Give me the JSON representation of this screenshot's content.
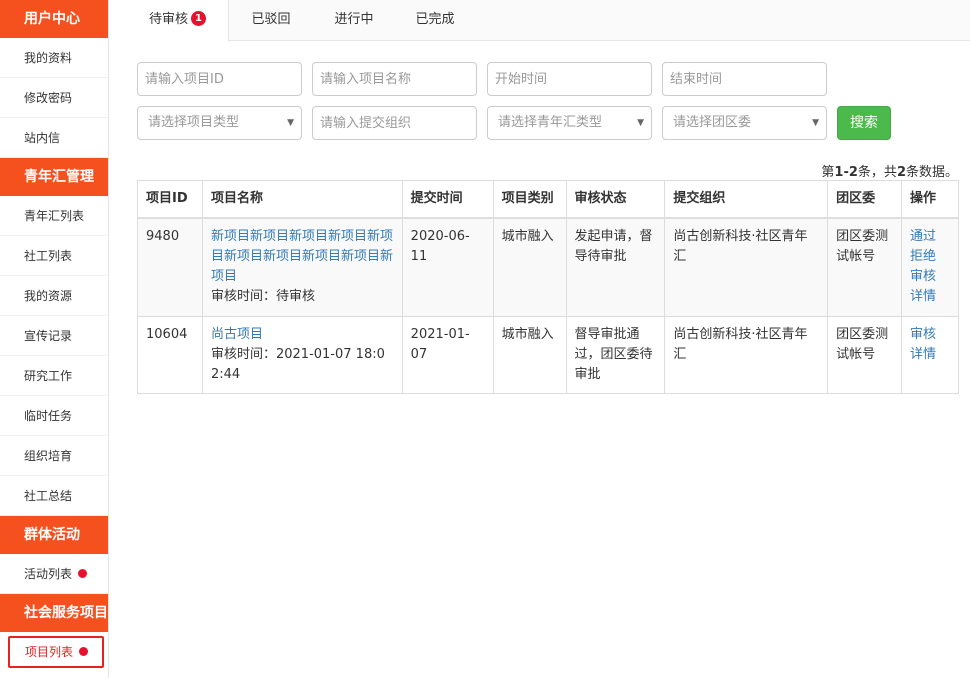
{
  "sidebar": {
    "sections": [
      {
        "title": "用户中心",
        "items": [
          {
            "label": "我的资料"
          },
          {
            "label": "修改密码"
          },
          {
            "label": "站内信"
          }
        ]
      },
      {
        "title": "青年汇管理",
        "items": [
          {
            "label": "青年汇列表"
          },
          {
            "label": "社工列表"
          },
          {
            "label": "我的资源"
          },
          {
            "label": "宣传记录"
          },
          {
            "label": "研究工作"
          },
          {
            "label": "临时任务"
          },
          {
            "label": "组织培育"
          },
          {
            "label": "社工总结"
          }
        ]
      },
      {
        "title": "群体活动",
        "items": [
          {
            "label": "活动列表",
            "dot": true
          }
        ]
      },
      {
        "title": "社会服务项目",
        "items": [
          {
            "label": "项目列表",
            "dot": true,
            "active": true
          }
        ]
      }
    ]
  },
  "tabs": [
    {
      "label": "待审核",
      "badge": "1",
      "active": true
    },
    {
      "label": "已驳回"
    },
    {
      "label": "进行中"
    },
    {
      "label": "已完成"
    }
  ],
  "filters": {
    "project_id_placeholder": "请输入项目ID",
    "project_name_placeholder": "请输入项目名称",
    "start_time_placeholder": "开始时间",
    "end_time_placeholder": "结束时间",
    "project_type_select": "请选择项目类型",
    "org_placeholder": "请输入提交组织",
    "youth_type_select": "请选择青年汇类型",
    "league_select": "请选择团区委",
    "search_label": "搜索"
  },
  "summary": {
    "prefix": "第",
    "range": "1-2",
    "middle": "条，共",
    "total": "2",
    "suffix": "条数据。"
  },
  "table": {
    "headers": [
      "项目ID",
      "项目名称",
      "提交时间",
      "项目类别",
      "审核状态",
      "提交组织",
      "团区委",
      "操作"
    ],
    "rows": [
      {
        "id": "9480",
        "name": "新项目新项目新项目新项目新项目新项目新项目新项目新项目新项目",
        "review_time": "审核时间：待审核",
        "submit_time": "2020-06-11",
        "category": "城市融入",
        "status": "发起申请，督导待审批",
        "org": "尚古创新科技·社区青年汇",
        "league": "团区委测试帐号",
        "ops": [
          "通过",
          "拒绝",
          "审核",
          "详情"
        ]
      },
      {
        "id": "10604",
        "name": "尚古项目",
        "review_time": "审核时间：2021-01-07 18:02:44",
        "submit_time": "2021-01-07",
        "category": "城市融入",
        "status": "督导审批通过，团区委待审批",
        "org": "尚古创新科技·社区青年汇",
        "league": "团区委测试帐号",
        "ops": [
          "审核",
          "详情"
        ]
      }
    ]
  },
  "colors": {
    "accent": "#f5511e",
    "link": "#337ab7",
    "search": "#4bb94b",
    "badge": "#e8112d"
  }
}
